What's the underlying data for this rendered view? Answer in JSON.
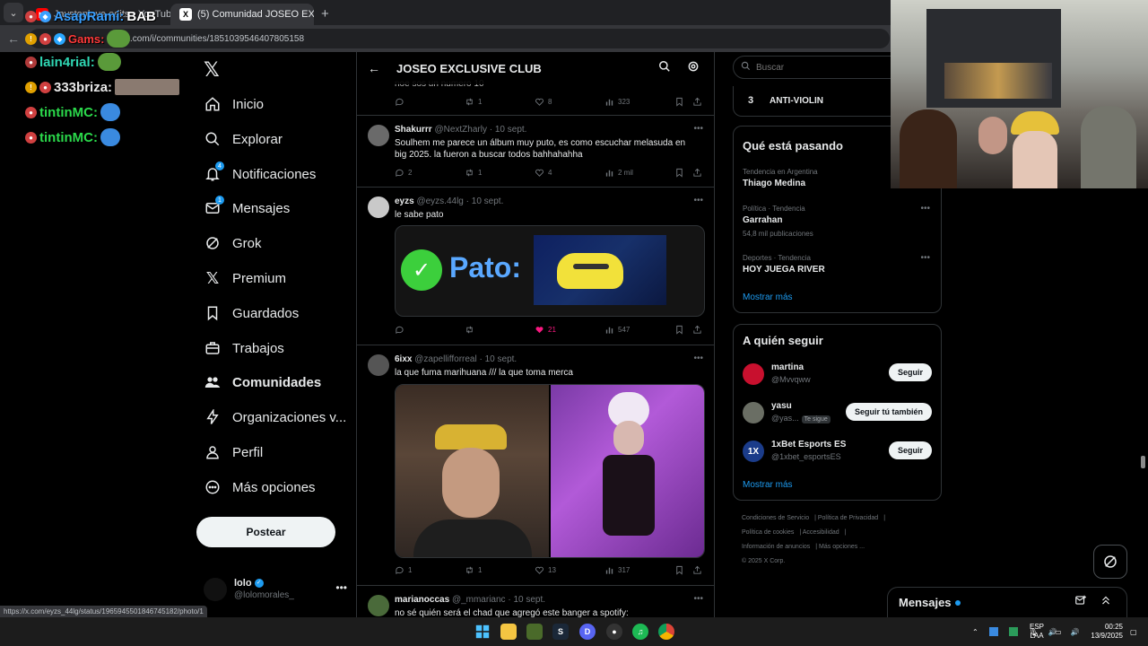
{
  "browser": {
    "tabs": [
      {
        "title": "Jaystonlove.edits - YouTube"
      },
      {
        "title": "(5) Comunidad JOSEO EXCLUSI"
      }
    ],
    "address": "x.com/i/communities/1851039546407805158",
    "status_url": "https://x.com/eyzs_44lg/status/1965945501846745182/photo/1"
  },
  "overlay": {
    "rows": [
      {
        "name": "AsapRami:",
        "msg": "BAB",
        "color": "#3aa0ff"
      },
      {
        "name": "Gams:",
        "msg": "",
        "color": "#ff3a3a"
      },
      {
        "name": "lain4rial:",
        "msg": "",
        "color": "#2fd6b3"
      },
      {
        "name": "333briza:",
        "msg": "",
        "color": "#e8e8e8"
      },
      {
        "name": "tintinMC:",
        "msg": "",
        "color": "#2bd94b"
      },
      {
        "name": "tintinMC:",
        "msg": "",
        "color": "#2bd94b"
      }
    ]
  },
  "nav": {
    "items": [
      {
        "label": "Inicio"
      },
      {
        "label": "Explorar"
      },
      {
        "label": "Notificaciones",
        "badge": "4"
      },
      {
        "label": "Mensajes",
        "badge": "1"
      },
      {
        "label": "Grok"
      },
      {
        "label": "Premium"
      },
      {
        "label": "Guardados"
      },
      {
        "label": "Trabajos"
      },
      {
        "label": "Comunidades"
      },
      {
        "label": "Organizaciones v..."
      },
      {
        "label": "Perfil"
      },
      {
        "label": "Más opciones"
      }
    ],
    "post_label": "Postear",
    "account": {
      "name": "lolo",
      "handle": "@lolomorales_"
    }
  },
  "community": {
    "title": "JOSEO EXCLUSIVE CLUB",
    "partial_text": "noe sos un numero 10",
    "partial_stats": {
      "reply": "",
      "repost": "1",
      "like": "8",
      "views": "323"
    },
    "tweets": [
      {
        "name": "Shakurrr",
        "handle": "@NextZharly",
        "date": "10 sept.",
        "text": "Soulhem me parece un álbum muy puto, es como escuchar melasuda en big 2025. la fueron a buscar todos bahhahahha",
        "reply": "2",
        "repost": "1",
        "like": "4",
        "views": "2 mil"
      },
      {
        "name": "eyzs",
        "handle": "@eyzs.44lg",
        "date": "10 sept.",
        "text": "le sabe pato",
        "media_text": "Pato:",
        "reply": "",
        "repost": "",
        "like": "21",
        "views": "547"
      },
      {
        "name": "6ixx",
        "handle": "@zapellifforreal",
        "date": "10 sept.",
        "text": "la que fuma marihuana  ///  la que toma merca",
        "reply": "1",
        "repost": "1",
        "like": "13",
        "views": "317"
      },
      {
        "name": "marianoccas",
        "handle": "@_mmarianc",
        "date": "10 sept.",
        "text": "no sé quién será el chad que agregó este banger a spotify:"
      }
    ]
  },
  "right": {
    "search_placeholder": "Buscar",
    "community_item": {
      "rank": "3",
      "name": "ANTI-VIOLIN"
    },
    "trends_title": "Qué está pasando",
    "trends": [
      {
        "category": "Tendencia en Argentina",
        "name": "Thiago Medina",
        "count": ""
      },
      {
        "category": "Política · Tendencia",
        "name": "Garrahan",
        "count": "54,8 mil publicaciones"
      },
      {
        "category": "Deportes · Tendencia",
        "name": "HOY JUEGA RIVER",
        "count": ""
      }
    ],
    "show_more": "Mostrar más",
    "who_title": "A quién seguir",
    "who": [
      {
        "name": "martina",
        "handle": "@Mvvqww",
        "tag": "",
        "button": "Seguir"
      },
      {
        "name": "yasu",
        "handle": "@yas...",
        "tag": "Te sigue",
        "button": "Seguir tú también"
      },
      {
        "name": "1xBet Esports ES",
        "handle": "@1xbet_esportsES",
        "tag": "",
        "button": "Seguir"
      }
    ],
    "footer": [
      "Condiciones de Servicio",
      "Política de Privacidad",
      "Política de cookies",
      "Accesibilidad",
      "Información de anuncios",
      "Más opciones ...",
      "© 2025 X Corp."
    ]
  },
  "messages": {
    "title": "Mensajes"
  },
  "taskbar": {
    "lang1": "ESP",
    "lang2": "LAA",
    "time": "00:25",
    "date": "13/9/2025"
  }
}
